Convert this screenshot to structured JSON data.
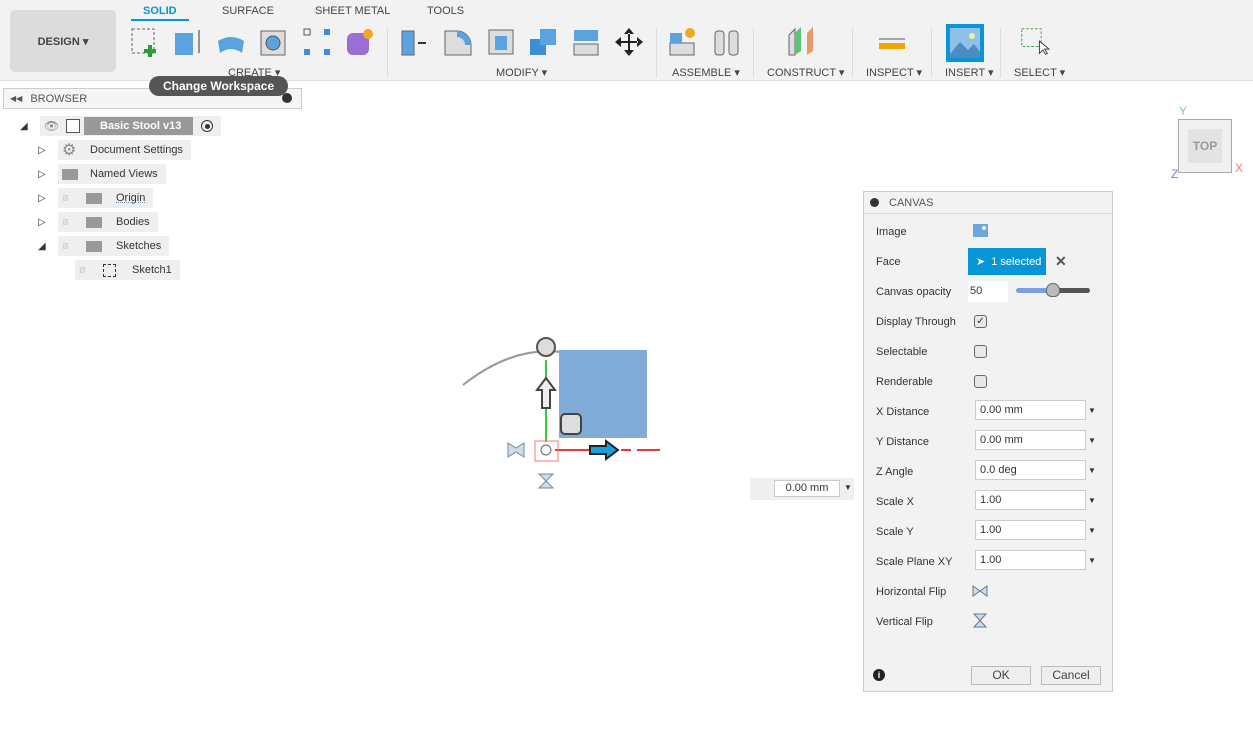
{
  "toolbar": {
    "design": "DESIGN ▾",
    "tabs": [
      "SOLID",
      "SURFACE",
      "SHEET METAL",
      "TOOLS"
    ],
    "groups": [
      "CREATE ▾",
      "MODIFY ▾",
      "ASSEMBLE ▾",
      "CONSTRUCT ▾",
      "INSPECT ▾",
      "INSERT ▾",
      "SELECT ▾"
    ],
    "tooltip": "Change Workspace"
  },
  "browser": {
    "title": "BROWSER",
    "root": "Basic Stool v13",
    "items": [
      "Document Settings",
      "Named Views",
      "Origin",
      "Bodies",
      "Sketches"
    ],
    "child": "Sketch1"
  },
  "viewcube": {
    "face": "TOP",
    "x": "X",
    "y": "Y",
    "z": "Z"
  },
  "viewport": {
    "distance": "0.00 mm"
  },
  "canvas": {
    "title": "CANVAS",
    "labels": {
      "image": "Image",
      "face": "Face",
      "opacity": "Canvas opacity",
      "display": "Display Through",
      "selectable": "Selectable",
      "renderable": "Renderable",
      "xdist": "X Distance",
      "ydist": "Y Distance",
      "zangle": "Z Angle",
      "scalex": "Scale X",
      "scaley": "Scale Y",
      "scalexy": "Scale Plane XY",
      "hflip": "Horizontal Flip",
      "vflip": "Vertical Flip"
    },
    "face_value": "1 selected",
    "opacity": "50",
    "display_through": true,
    "selectable_checked": false,
    "renderable_checked": false,
    "xdist": "0.00 mm",
    "ydist": "0.00 mm",
    "zangle": "0.0 deg",
    "scalex": "1.00",
    "scaley": "1.00",
    "scalexy": "1.00",
    "ok": "OK",
    "cancel": "Cancel"
  },
  "colors": {
    "accent": "#0696d7",
    "canvas_image": "#7fabd6"
  }
}
